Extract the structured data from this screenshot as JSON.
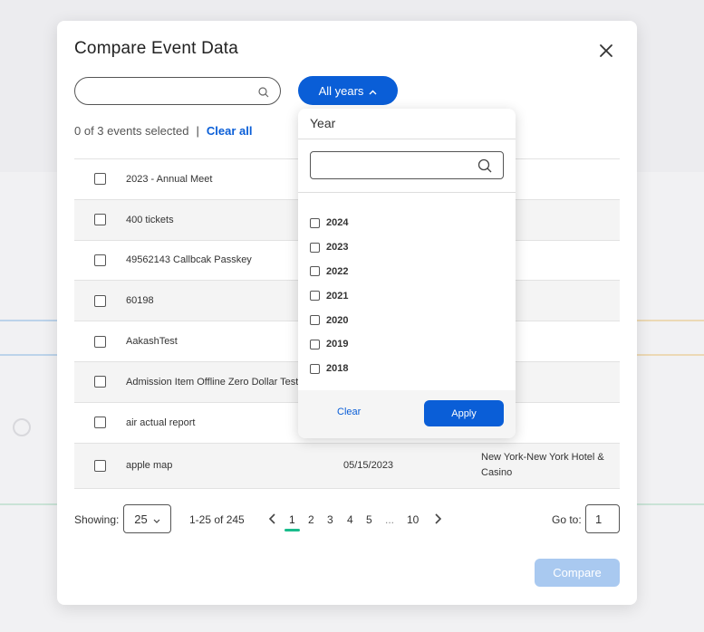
{
  "modal": {
    "title": "Compare Event Data",
    "search": {
      "value": "",
      "placeholder": ""
    },
    "year_filter_label": "All years",
    "selection": {
      "text": "0 of 3 events selected",
      "separator": "|",
      "clear_all": "Clear all"
    },
    "events": [
      {
        "name": "2023 - Annual Meet",
        "date": "",
        "venue": ""
      },
      {
        "name": "400 tickets",
        "date": "",
        "venue": ""
      },
      {
        "name": "49562143 Callbcak Passkey",
        "date": "",
        "venue": ""
      },
      {
        "name": "60198",
        "date": "",
        "venue": ""
      },
      {
        "name": "AakashTest",
        "date": "",
        "venue": ""
      },
      {
        "name": "Admission Item Offline Zero Dollar Test",
        "date": "",
        "venue": ""
      },
      {
        "name": "air actual report",
        "date": "",
        "venue": ""
      },
      {
        "name": "apple map",
        "date": "05/15/2023",
        "venue": "New York-New York Hotel & Casino"
      }
    ],
    "pagination": {
      "showing_label": "Showing:",
      "page_size": "25",
      "range": "1-25 of 245",
      "pages": [
        "1",
        "2",
        "3",
        "4",
        "5",
        "...",
        "10"
      ],
      "current_page": "1",
      "goto_label": "Go to:",
      "goto_value": "1"
    },
    "compare_label": "Compare"
  },
  "year_dropdown": {
    "title": "Year",
    "search": {
      "value": "",
      "placeholder": ""
    },
    "options": [
      "2024",
      "2023",
      "2022",
      "2021",
      "2020",
      "2019",
      "2018"
    ],
    "clear_label": "Clear",
    "apply_label": "Apply"
  },
  "colors": {
    "primary": "#0a5ed7",
    "disabled_primary": "#a9c9f0",
    "active_page_underline": "#1abc8c"
  }
}
